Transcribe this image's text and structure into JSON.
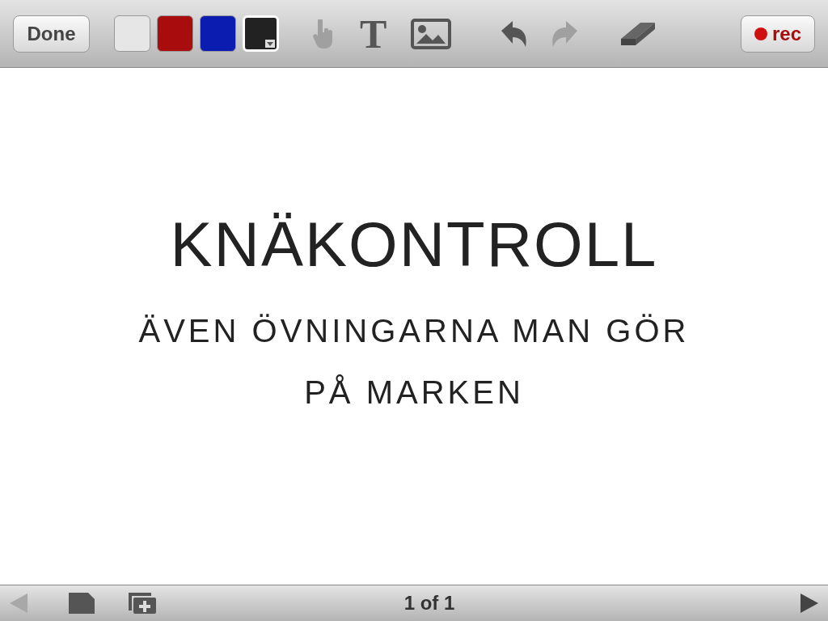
{
  "toolbar": {
    "done": "Done",
    "swatches": [
      {
        "color": "#e6e6e6",
        "selected": false
      },
      {
        "color": "#a80c0c",
        "selected": false
      },
      {
        "color": "#0a1db0",
        "selected": false
      },
      {
        "color": "#222222",
        "selected": true
      }
    ],
    "hand_disabled": true,
    "text_tool": "T",
    "undo_disabled": false,
    "redo_disabled": true,
    "rec": "rec"
  },
  "canvas": {
    "lines": [
      "KNÄKONTROLL",
      "ÄVEN ÖVNINGARNA MAN GÖR",
      "PÅ MARKEN"
    ]
  },
  "bottom_bar": {
    "prev_disabled": true,
    "next_disabled": false,
    "page": "1 of 1"
  }
}
